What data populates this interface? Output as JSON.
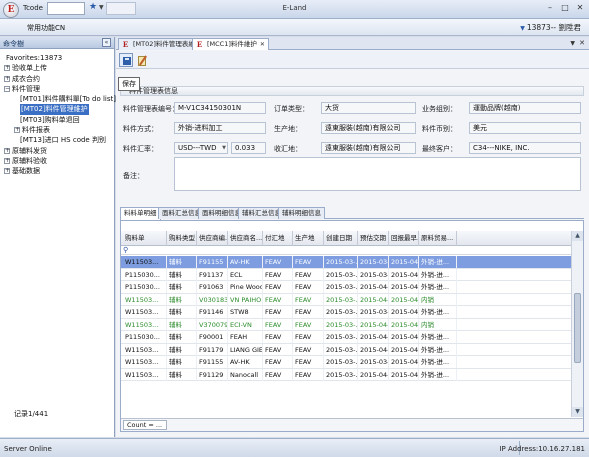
{
  "window": {
    "tcode_label": "Tcode",
    "title": "E-Land",
    "minimize": "–",
    "maximize": "□",
    "close": "✕"
  },
  "menubar": {
    "favorites_label": "常用功能CN",
    "user": "13873-- 劉陞君"
  },
  "left_panel": {
    "title": "命令樹",
    "collapse": "«",
    "tree": [
      {
        "label": "Favorites:13873",
        "level": 0,
        "toggle": ""
      },
      {
        "label": "验收单上传",
        "level": 0,
        "toggle": "+"
      },
      {
        "label": "成衣合约",
        "level": 0,
        "toggle": "+"
      },
      {
        "label": "料件管理",
        "level": 0,
        "toggle": "−"
      },
      {
        "label": "[MT01]料件購料單[To do list]",
        "level": 2,
        "toggle": ""
      },
      {
        "label": "[MT02]料件管理維护",
        "level": 2,
        "toggle": "",
        "selected": true
      },
      {
        "label": "[MT03]购料单退回",
        "level": 2,
        "toggle": ""
      },
      {
        "label": "料件报表",
        "level": 1,
        "toggle": "+"
      },
      {
        "label": "[MT13]进口 HS code 判别",
        "level": 2,
        "toggle": ""
      },
      {
        "label": "原辅料发货",
        "level": 0,
        "toggle": "+"
      },
      {
        "label": "原辅料验收",
        "level": 0,
        "toggle": "+"
      },
      {
        "label": "基础数据",
        "level": 0,
        "toggle": "+"
      }
    ]
  },
  "doc_tabs": [
    {
      "label": "[MT02]料件管理表維护",
      "active": false
    },
    {
      "label": "[MCC1]料件維护",
      "active": true
    }
  ],
  "tabstrip": {
    "menu": "▼",
    "close": "✕"
  },
  "toolbar": {
    "save_tooltip": "保存"
  },
  "section_title": "料件管理表信息",
  "form": {
    "order_no_label": "料件管理表编号：",
    "order_no": "M-V1C34150301N",
    "order_type_label": "订单类型：",
    "order_type": "大货",
    "business_label": "业务组别：",
    "business": "運動品牌(越南)",
    "method_label": "料件方式：",
    "method": "外销-进料加工",
    "producer_label": "生产地：",
    "producer": "遠東服裝(越南)有限公司",
    "currency_label": "料件币别：",
    "currency": "美元",
    "rate_label": "料件汇率：",
    "rate_pair": "USD---TWD",
    "rate_value": "0.033",
    "receiver_label": "收汇地：",
    "receiver": "遠東服裝(越南)有限公司",
    "customer_label": "最终客户：",
    "customer": "C34---NIKE, INC.",
    "remark_label": "备注：",
    "remark": ""
  },
  "sub_tabs": [
    {
      "label": "料料单明细",
      "active": true
    },
    {
      "label": "面料汇总信息",
      "active": false
    },
    {
      "label": "面料明细信息",
      "active": false
    },
    {
      "label": "辅料汇总信息",
      "active": false
    },
    {
      "label": "辅料明细信息",
      "active": false
    }
  ],
  "grid": {
    "group_icon": "⚲",
    "columns": [
      "购料单",
      "购料类型",
      "供应商编...",
      "供应商名...",
      "付汇地",
      "生产地",
      "创建日期",
      "预估交期",
      "回报最早...",
      "原料贸易..."
    ],
    "rows": [
      {
        "cells": [
          "W11503...",
          "辅料",
          "F91155",
          "AV-HK",
          "FEAV",
          "FEAV",
          "2015-03-...",
          "2015-03-...",
          "2015-04-...",
          "外销-进..."
        ],
        "selected": true,
        "green": false
      },
      {
        "cells": [
          "P115030...",
          "辅料",
          "F91137",
          "ECL",
          "FEAV",
          "FEAV",
          "2015-03-...",
          "2015-03-...",
          "2015-04-...",
          "外销-进..."
        ],
        "selected": false,
        "green": false
      },
      {
        "cells": [
          "P115030...",
          "辅料",
          "F91063",
          "Pine Wood",
          "FEAV",
          "FEAV",
          "2015-03-...",
          "2015-04-...",
          "2015-04-...",
          "外销-进..."
        ],
        "selected": false,
        "green": false
      },
      {
        "cells": [
          "W11503...",
          "辅料",
          "V030183...",
          "VN PAIHO",
          "FEAV",
          "FEAV",
          "2015-03-...",
          "2015-04-...",
          "2015-04-...",
          "内销"
        ],
        "selected": false,
        "green": true
      },
      {
        "cells": [
          "W11503...",
          "辅料",
          "F91146",
          "STW8",
          "FEAV",
          "FEAV",
          "2015-03-...",
          "2015-03-...",
          "2015-04-...",
          "外销-进..."
        ],
        "selected": false,
        "green": false
      },
      {
        "cells": [
          "W11503...",
          "辅料",
          "V370079...",
          "ECI-VN",
          "FEAV",
          "FEAV",
          "2015-03-...",
          "2015-04-...",
          "2015-04-...",
          "内销"
        ],
        "selected": false,
        "green": true
      },
      {
        "cells": [
          "P115030...",
          "辅料",
          "F90001",
          "FEAH",
          "FEAV",
          "FEAV",
          "2015-03-...",
          "2015-04-...",
          "2015-04-...",
          "外销-进..."
        ],
        "selected": false,
        "green": false
      },
      {
        "cells": [
          "W11503...",
          "辅料",
          "F91179",
          "LIANG GIE",
          "FEAV",
          "FEAV",
          "2015-03-...",
          "2015-04-...",
          "2015-04-...",
          "外销-进..."
        ],
        "selected": false,
        "green": false
      },
      {
        "cells": [
          "W11503...",
          "辅料",
          "F91155",
          "AV-HK",
          "FEAV",
          "FEAV",
          "2015-03-...",
          "2015-03-...",
          "2015-04-...",
          "外销-进..."
        ],
        "selected": false,
        "green": false
      },
      {
        "cells": [
          "W11503...",
          "辅料",
          "F91129",
          "Nanocall",
          "FEAV",
          "FEAV",
          "2015-03-...",
          "2015-04-...",
          "2015-04-...",
          "外销-进..."
        ],
        "selected": false,
        "green": false
      }
    ],
    "count_label": "Count = ...",
    "records": "记录1/441"
  },
  "status": {
    "left": "Server Online",
    "right": "IP Address:10.16.27.181"
  }
}
